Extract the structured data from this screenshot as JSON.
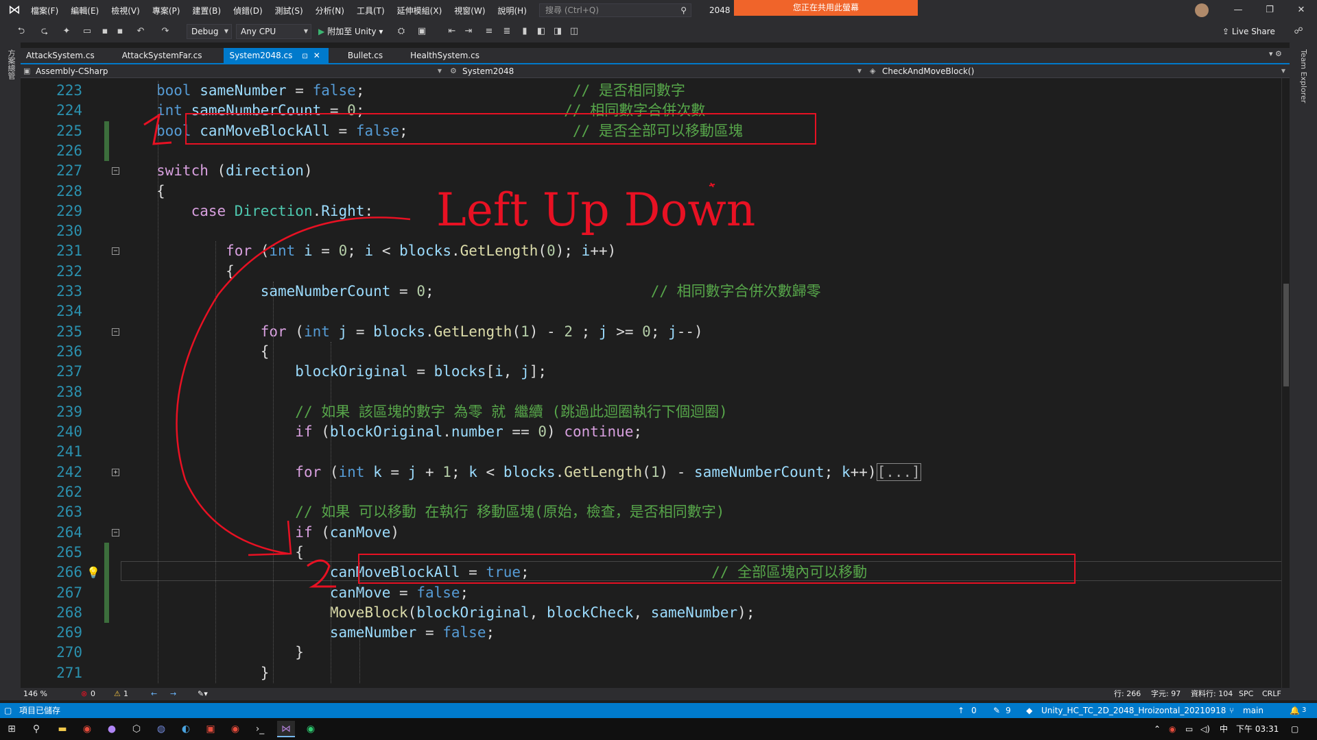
{
  "titlebar": {
    "menu": [
      "檔案(F)",
      "編輯(E)",
      "檢視(V)",
      "專案(P)",
      "建置(B)",
      "偵錯(D)",
      "測試(S)",
      "分析(N)",
      "工具(T)",
      "延伸模組(X)",
      "視窗(W)",
      "說明(H)"
    ],
    "search_placeholder": "搜尋 (Ctrl+Q)",
    "solution_name": "2048",
    "sharing_banner": "您正在共用此螢幕",
    "window_controls": [
      "—",
      "❐",
      "✕"
    ]
  },
  "toolbar": {
    "config": "Debug",
    "platform": "Any CPU",
    "attach_label": "附加至 Unity",
    "live_share": "Live Share"
  },
  "side_rails": {
    "left": "方案總管",
    "right": "Team Explorer"
  },
  "tabs": [
    {
      "label": "AttackSystem.cs",
      "active": false
    },
    {
      "label": "AttackSystemFar.cs",
      "active": false
    },
    {
      "label": "System2048.cs",
      "active": true
    },
    {
      "label": "Bullet.cs",
      "active": false
    },
    {
      "label": "HealthSystem.cs",
      "active": false
    }
  ],
  "navbar": {
    "project": "Assembly-CSharp",
    "class": "System2048",
    "member": "CheckAndMoveBlock()"
  },
  "code_lines": [
    {
      "num": "223",
      "tokens": [
        [
          "k",
          "bool "
        ],
        [
          "v",
          "sameNumber"
        ],
        [
          "p",
          " = "
        ],
        [
          "k",
          "false"
        ],
        [
          "p",
          ";"
        ],
        [
          "p",
          "                        "
        ],
        [
          "c",
          "// 是否相同數字"
        ]
      ]
    },
    {
      "num": "224",
      "tokens": [
        [
          "k",
          "int "
        ],
        [
          "v",
          "sameNumberCount"
        ],
        [
          "p",
          " = "
        ],
        [
          "n",
          "0"
        ],
        [
          "p",
          ";"
        ],
        [
          "p",
          "                       "
        ],
        [
          "c",
          "// 相同數字合併次數"
        ]
      ]
    },
    {
      "num": "225",
      "tokens": [
        [
          "k",
          "bool "
        ],
        [
          "v",
          "canMoveBlockAll"
        ],
        [
          "p",
          " = "
        ],
        [
          "k",
          "false"
        ],
        [
          "p",
          ";"
        ],
        [
          "p",
          "                   "
        ],
        [
          "c",
          "// 是否全部可以移動區塊"
        ]
      ]
    },
    {
      "num": "226",
      "tokens": []
    },
    {
      "num": "227",
      "tokens": [
        [
          "ctl",
          "switch"
        ],
        [
          "p",
          " ("
        ],
        [
          "v",
          "direction"
        ],
        [
          "p",
          ")"
        ]
      ]
    },
    {
      "num": "228",
      "tokens": [
        [
          "p",
          "{"
        ]
      ]
    },
    {
      "num": "229",
      "tokens": [
        [
          "p",
          "    "
        ],
        [
          "ctl",
          "case "
        ],
        [
          "t",
          "Direction"
        ],
        [
          "p",
          "."
        ],
        [
          "v",
          "Right"
        ],
        [
          "p",
          ":"
        ]
      ]
    },
    {
      "num": "230",
      "tokens": []
    },
    {
      "num": "231",
      "tokens": [
        [
          "p",
          "        "
        ],
        [
          "ctl",
          "for"
        ],
        [
          "p",
          " ("
        ],
        [
          "k",
          "int "
        ],
        [
          "v",
          "i"
        ],
        [
          "p",
          " = "
        ],
        [
          "n",
          "0"
        ],
        [
          "p",
          "; "
        ],
        [
          "v",
          "i"
        ],
        [
          "p",
          " < "
        ],
        [
          "v",
          "blocks"
        ],
        [
          "p",
          "."
        ],
        [
          "m",
          "GetLength"
        ],
        [
          "p",
          "("
        ],
        [
          "n",
          "0"
        ],
        [
          "p",
          "); "
        ],
        [
          "v",
          "i"
        ],
        [
          "p",
          "++)"
        ]
      ]
    },
    {
      "num": "232",
      "tokens": [
        [
          "p",
          "        {"
        ]
      ]
    },
    {
      "num": "233",
      "tokens": [
        [
          "p",
          "            "
        ],
        [
          "v",
          "sameNumberCount"
        ],
        [
          "p",
          " = "
        ],
        [
          "n",
          "0"
        ],
        [
          "p",
          ";"
        ],
        [
          "p",
          "                         "
        ],
        [
          "c",
          "// 相同數字合併次數歸零"
        ]
      ]
    },
    {
      "num": "234",
      "tokens": []
    },
    {
      "num": "235",
      "tokens": [
        [
          "p",
          "            "
        ],
        [
          "ctl",
          "for"
        ],
        [
          "p",
          " ("
        ],
        [
          "k",
          "int "
        ],
        [
          "v",
          "j"
        ],
        [
          "p",
          " = "
        ],
        [
          "v",
          "blocks"
        ],
        [
          "p",
          "."
        ],
        [
          "m",
          "GetLength"
        ],
        [
          "p",
          "("
        ],
        [
          "n",
          "1"
        ],
        [
          "p",
          ") - "
        ],
        [
          "n",
          "2"
        ],
        [
          "p",
          " ; "
        ],
        [
          "v",
          "j"
        ],
        [
          "p",
          " >= "
        ],
        [
          "n",
          "0"
        ],
        [
          "p",
          "; "
        ],
        [
          "v",
          "j"
        ],
        [
          "p",
          "--)"
        ]
      ]
    },
    {
      "num": "236",
      "tokens": [
        [
          "p",
          "            {"
        ]
      ]
    },
    {
      "num": "237",
      "tokens": [
        [
          "p",
          "                "
        ],
        [
          "v",
          "blockOriginal"
        ],
        [
          "p",
          " = "
        ],
        [
          "v",
          "blocks"
        ],
        [
          "p",
          "["
        ],
        [
          "v",
          "i"
        ],
        [
          "p",
          ", "
        ],
        [
          "v",
          "j"
        ],
        [
          "p",
          "];"
        ]
      ]
    },
    {
      "num": "238",
      "tokens": []
    },
    {
      "num": "239",
      "tokens": [
        [
          "p",
          "                "
        ],
        [
          "c",
          "// 如果 該區塊的數字 為零 就 繼續 (跳過此迴圈執行下個迴圈)"
        ]
      ]
    },
    {
      "num": "240",
      "tokens": [
        [
          "p",
          "                "
        ],
        [
          "ctl",
          "if"
        ],
        [
          "p",
          " ("
        ],
        [
          "v",
          "blockOriginal"
        ],
        [
          "p",
          "."
        ],
        [
          "v",
          "number"
        ],
        [
          "p",
          " == "
        ],
        [
          "n",
          "0"
        ],
        [
          "p",
          ") "
        ],
        [
          "ctl",
          "continue"
        ],
        [
          "p",
          ";"
        ]
      ]
    },
    {
      "num": "241",
      "tokens": []
    },
    {
      "num": "242",
      "tokens": [
        [
          "p",
          "                "
        ],
        [
          "ctl",
          "for"
        ],
        [
          "p",
          " ("
        ],
        [
          "k",
          "int "
        ],
        [
          "v",
          "k"
        ],
        [
          "p",
          " = "
        ],
        [
          "v",
          "j"
        ],
        [
          "p",
          " + "
        ],
        [
          "n",
          "1"
        ],
        [
          "p",
          "; "
        ],
        [
          "v",
          "k"
        ],
        [
          "p",
          " < "
        ],
        [
          "v",
          "blocks"
        ],
        [
          "p",
          "."
        ],
        [
          "m",
          "GetLength"
        ],
        [
          "p",
          "("
        ],
        [
          "n",
          "1"
        ],
        [
          "p",
          ") - "
        ],
        [
          "v",
          "sameNumberCount"
        ],
        [
          "p",
          "; "
        ],
        [
          "v",
          "k"
        ],
        [
          "p",
          "++)"
        ],
        [
          "p",
          "[...]"
        ]
      ]
    },
    {
      "num": "262",
      "tokens": []
    },
    {
      "num": "263",
      "tokens": [
        [
          "p",
          "                "
        ],
        [
          "c",
          "// 如果 可以移動 在執行 移動區塊(原始，檢查，是否相同數字)"
        ]
      ]
    },
    {
      "num": "264",
      "tokens": [
        [
          "p",
          "                "
        ],
        [
          "ctl",
          "if"
        ],
        [
          "p",
          " ("
        ],
        [
          "v",
          "canMove"
        ],
        [
          "p",
          ")"
        ]
      ]
    },
    {
      "num": "265",
      "tokens": [
        [
          "p",
          "                {"
        ]
      ]
    },
    {
      "num": "266",
      "tokens": [
        [
          "p",
          "                    "
        ],
        [
          "v",
          "canMoveBlockAll"
        ],
        [
          "p",
          " = "
        ],
        [
          "k",
          "true"
        ],
        [
          "p",
          ";"
        ],
        [
          "p",
          "                     "
        ],
        [
          "c",
          "// 全部區塊內可以移動"
        ]
      ]
    },
    {
      "num": "267",
      "tokens": [
        [
          "p",
          "                    "
        ],
        [
          "v",
          "canMove"
        ],
        [
          "p",
          " = "
        ],
        [
          "k",
          "false"
        ],
        [
          "p",
          ";"
        ]
      ]
    },
    {
      "num": "268",
      "tokens": [
        [
          "p",
          "                    "
        ],
        [
          "m",
          "MoveBlock"
        ],
        [
          "p",
          "("
        ],
        [
          "v",
          "blockOriginal"
        ],
        [
          "p",
          ", "
        ],
        [
          "v",
          "blockCheck"
        ],
        [
          "p",
          ", "
        ],
        [
          "v",
          "sameNumber"
        ],
        [
          "p",
          ");"
        ]
      ]
    },
    {
      "num": "269",
      "tokens": [
        [
          "p",
          "                    "
        ],
        [
          "v",
          "sameNumber"
        ],
        [
          "p",
          " = "
        ],
        [
          "k",
          "false"
        ],
        [
          "p",
          ";"
        ]
      ]
    },
    {
      "num": "270",
      "tokens": [
        [
          "p",
          "                }"
        ]
      ]
    },
    {
      "num": "271",
      "tokens": [
        [
          "p",
          "            }"
        ]
      ]
    }
  ],
  "annotation": {
    "label": "Left Up Down",
    "marker_1": "1",
    "marker_2": "2",
    "color": "#e81123"
  },
  "zoombar": {
    "zoom": "146 %",
    "errors": "0",
    "warnings": "1",
    "line": "行: 266",
    "char": "字元: 97",
    "col": "資料行: 104",
    "spacing": "SPC",
    "eol": "CRLF"
  },
  "statusbar": {
    "message": "項目已儲存",
    "up_count": "0",
    "pencil_count": "9",
    "repo": "Unity_HC_TC_2D_2048_Hroizontal_20210918",
    "branch": "main",
    "notifications": "3"
  },
  "taskbar": {
    "ime": "中",
    "time": "下午 03:31"
  },
  "colors": {
    "accent": "#007acc",
    "banner": "#f0642a",
    "annotation": "#e81123"
  }
}
